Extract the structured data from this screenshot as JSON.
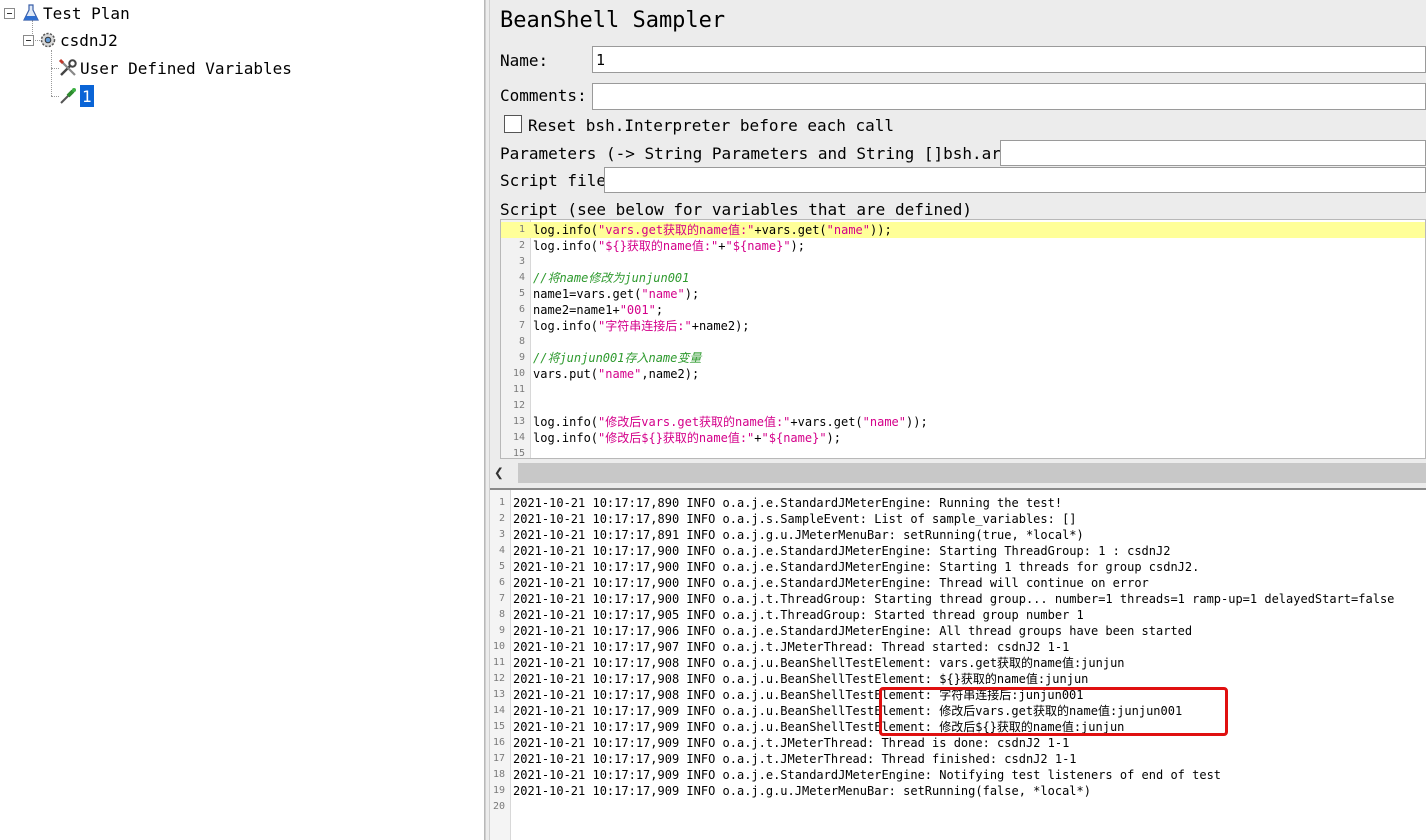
{
  "tree": {
    "items": [
      {
        "label": "Test Plan",
        "icon": "flask-icon"
      },
      {
        "label": "csdnJ2",
        "icon": "gear-icon"
      },
      {
        "label": "User Defined Variables",
        "icon": "wrench-icon"
      },
      {
        "label": "1",
        "icon": "dropper-icon",
        "selected": true
      }
    ]
  },
  "editor": {
    "title": "BeanShell Sampler",
    "name_label": "Name:",
    "name_value": "1",
    "comments_label": "Comments:",
    "comments_value": "",
    "reset_label": "Reset bsh.Interpreter before each call",
    "reset_checked": false,
    "params_label": "Parameters (-> String Parameters and String []bsh.args)",
    "params_value": "",
    "script_file_label": "Script file",
    "script_file_value": "",
    "script_label": "Script (see below for variables that are defined)"
  },
  "script_lines": [
    {
      "n": "1",
      "text": "log.info(\"vars.get获取的name值:\"+vars.get(\"name\"));"
    },
    {
      "n": "2",
      "text": "log.info(\"${}获取的name值:\"+\"${name}\");"
    },
    {
      "n": "3",
      "text": ""
    },
    {
      "n": "4",
      "text": "//将name修改为junjun001"
    },
    {
      "n": "5",
      "text": "name1=vars.get(\"name\");"
    },
    {
      "n": "6",
      "text": "name2=name1+\"001\";"
    },
    {
      "n": "7",
      "text": "log.info(\"字符串连接后:\"+name2);"
    },
    {
      "n": "8",
      "text": ""
    },
    {
      "n": "9",
      "text": "//将junjun001存入name变量"
    },
    {
      "n": "10",
      "text": "vars.put(\"name\",name2);"
    },
    {
      "n": "11",
      "text": ""
    },
    {
      "n": "12",
      "text": ""
    },
    {
      "n": "13",
      "text": "log.info(\"修改后vars.get获取的name值:\"+vars.get(\"name\"));"
    },
    {
      "n": "14",
      "text": "log.info(\"修改后${}获取的name值:\"+\"${name}\");"
    },
    {
      "n": "15",
      "text": ""
    }
  ],
  "log_lines": [
    {
      "n": "1",
      "text": "2021-10-21 10:17:17,890 INFO o.a.j.e.StandardJMeterEngine: Running the test!"
    },
    {
      "n": "2",
      "text": "2021-10-21 10:17:17,890 INFO o.a.j.s.SampleEvent: List of sample_variables: []"
    },
    {
      "n": "3",
      "text": "2021-10-21 10:17:17,891 INFO o.a.j.g.u.JMeterMenuBar: setRunning(true, *local*)"
    },
    {
      "n": "4",
      "text": "2021-10-21 10:17:17,900 INFO o.a.j.e.StandardJMeterEngine: Starting ThreadGroup: 1 : csdnJ2"
    },
    {
      "n": "5",
      "text": "2021-10-21 10:17:17,900 INFO o.a.j.e.StandardJMeterEngine: Starting 1 threads for group csdnJ2."
    },
    {
      "n": "6",
      "text": "2021-10-21 10:17:17,900 INFO o.a.j.e.StandardJMeterEngine: Thread will continue on error"
    },
    {
      "n": "7",
      "text": "2021-10-21 10:17:17,900 INFO o.a.j.t.ThreadGroup: Starting thread group... number=1 threads=1 ramp-up=1 delayedStart=false"
    },
    {
      "n": "8",
      "text": "2021-10-21 10:17:17,905 INFO o.a.j.t.ThreadGroup: Started thread group number 1"
    },
    {
      "n": "9",
      "text": "2021-10-21 10:17:17,906 INFO o.a.j.e.StandardJMeterEngine: All thread groups have been started"
    },
    {
      "n": "10",
      "text": "2021-10-21 10:17:17,907 INFO o.a.j.t.JMeterThread: Thread started: csdnJ2 1-1"
    },
    {
      "n": "11",
      "text": "2021-10-21 10:17:17,908 INFO o.a.j.u.BeanShellTestElement: vars.get获取的name值:junjun"
    },
    {
      "n": "12",
      "text": "2021-10-21 10:17:17,908 INFO o.a.j.u.BeanShellTestElement: ${}获取的name值:junjun"
    },
    {
      "n": "13",
      "text": "2021-10-21 10:17:17,908 INFO o.a.j.u.BeanShellTestElement: 字符串连接后:junjun001"
    },
    {
      "n": "14",
      "text": "2021-10-21 10:17:17,909 INFO o.a.j.u.BeanShellTestElement: 修改后vars.get获取的name值:junjun001"
    },
    {
      "n": "15",
      "text": "2021-10-21 10:17:17,909 INFO o.a.j.u.BeanShellTestElement: 修改后${}获取的name值:junjun"
    },
    {
      "n": "16",
      "text": "2021-10-21 10:17:17,909 INFO o.a.j.t.JMeterThread: Thread is done: csdnJ2 1-1"
    },
    {
      "n": "17",
      "text": "2021-10-21 10:17:17,909 INFO o.a.j.t.JMeterThread: Thread finished: csdnJ2 1-1"
    },
    {
      "n": "18",
      "text": "2021-10-21 10:17:17,909 INFO o.a.j.e.StandardJMeterEngine: Notifying test listeners of end of test"
    },
    {
      "n": "19",
      "text": "2021-10-21 10:17:17,909 INFO o.a.j.g.u.JMeterMenuBar: setRunning(false, *local*)"
    },
    {
      "n": "20",
      "text": ""
    }
  ],
  "colors": {
    "selection": "#0a64d6",
    "highlight_line": "#ffff99",
    "string": "#d4008a",
    "comment": "#2e9a2e",
    "annotation_box": "#e01010"
  }
}
